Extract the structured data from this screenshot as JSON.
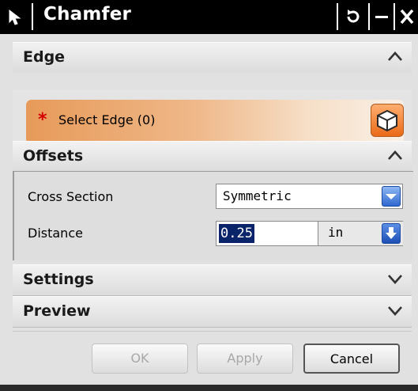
{
  "window": {
    "title": "Chamfer",
    "controls": {
      "reset": "↺",
      "minimize": "–",
      "close": "✕"
    }
  },
  "sections": {
    "edge": {
      "label": "Edge",
      "expanded": true
    },
    "offsets": {
      "label": "Offsets",
      "expanded": true
    },
    "settings": {
      "label": "Settings",
      "expanded": false
    },
    "preview": {
      "label": "Preview",
      "expanded": false
    }
  },
  "edge": {
    "required_marker": "*",
    "select_label": "Select Edge (0)",
    "select_icon": "solid-cube-icon"
  },
  "offsets": {
    "cross_section_label": "Cross Section",
    "cross_section_value": "Symmetric",
    "distance_label": "Distance",
    "distance_value": "0.25",
    "distance_unit": "in"
  },
  "footer": {
    "ok_label": "OK",
    "apply_label": "Apply",
    "cancel_label": "Cancel"
  },
  "colors": {
    "titlebar": "#000000",
    "selection_gradient_start": "#e79a59",
    "required_star": "#d40000",
    "combo_arrow": "#2f68cf",
    "text_highlight": "#0a246a"
  }
}
